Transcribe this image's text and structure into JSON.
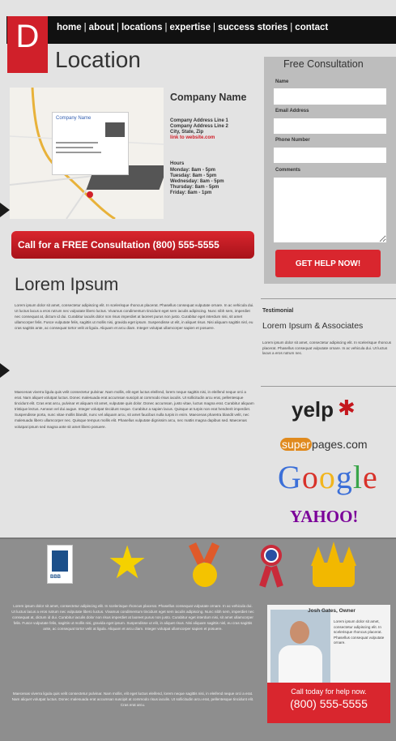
{
  "logo": {
    "letter": "D"
  },
  "nav": {
    "items": [
      "home",
      "about",
      "locations",
      "expertise",
      "success stories",
      "contact"
    ],
    "separator": "|"
  },
  "location": {
    "title": "Location",
    "company_name": "Company Name",
    "address_lines": [
      "Company Address Line 1",
      "Company Address Line 2",
      "City, State, Zip"
    ],
    "website_link": "link to website.com",
    "hours_label": "Hours",
    "hours": [
      "Monday: 8am - 5pm",
      "Tuesday: 8am - 5pm",
      "Wednesday: 8am - 5pm",
      "Thursday: 8am - 5pm",
      "Friday: 8am - 1pm"
    ]
  },
  "cta_bar": {
    "label": "Call for a FREE Consultation (800) 555-5555"
  },
  "content": {
    "title": "Lorem Ipsum",
    "paragraph_1": "Lorem ipsum dolor sit amet, consectetur adipiscing elit. In scelerisque rhoncus placerat. Phasellus consequat vulputate ornare. In ac vehicula dui. Ut luctus lacus a eros rutrum nec vulputate libero luctus. Vivamus condimentum tincidunt eget sem iaculis adipiscing. Nunc nibh sem, imperdiet nec consequat at, dictum id dui. Curabitur iaculis dolor non risus imperdiet at laoreet purus non justo. Curabitur eget interdum nisi, sit amet ullamcorper felis. Fusce vulputate felis, sagittis ut mollis nisi, gravida eget ipsum. Suspendisse ut elit, in aliquet risus. Nisi aliquam sagittis nisl, eu cras sagittis ante, ac consequat tortor velit at ligula. Aliquam et arcu diam. Integer volutpat ullamcorper sapien et posuere.",
    "paragraph_2": "Maecenas viverra ligula quis velit consectetur pulvinar. Nam mollis, elit eget luctus eleifend, lorem neque sagittis nisi, in eleifend neque orci a erat. Nam aliquet volutpat luctus. Donec malesuada erat accumsan suscipit at commodo risus iaculis. Ut sollicitudin arcu erat, pellentesque tincidunt elit. Cras erat arcu, pulvinar et aliquam sit amet, vulputate quis dolor. Donec accumsan, justo vitae, luctus magna erat. Curabitur aliquam tristique lectus. Aenean vel dui augue. Integer volutpat tincidunt neque. Curabitur a sapien lacus. Quisque at turpis non erat hendrerit imperdiet. Suspendisse porta, nunc vitae mollis blandit, nunc vel aliquam arcu, sit amet faucibus nulla turpis in enim. Maecenas pharetra blandit velit, nec malesuada libero ullamcorper nec. Quisque tempus mollis elit. Phasellus vulputate dignissim arcu, nec mattis magna dapibus sed. Maecenas volutpat ipsum sed magna ante sit amet libero posuere."
  },
  "form": {
    "title": "Free Consultation",
    "fields": [
      {
        "label": "Name",
        "value": ""
      },
      {
        "label": "Email Address",
        "value": ""
      },
      {
        "label": "Phone Number",
        "value": ""
      },
      {
        "label": "Comments",
        "value": ""
      }
    ],
    "submit_label": "GET HELP NOW!"
  },
  "testimonial": {
    "label": "Testimonial",
    "name": "Lorem Ipsum & Associates",
    "text": "Lorem ipsum dolor sit amet, consectetur adipiscing elit. In scelerisque rhoncus placerat. Phasellus consequat vulputate ornare. In ac vehicula dui. Ut luctus lacus a eros rutrum nec."
  },
  "review_sites": {
    "yelp": "yelp",
    "yelp_mark": "✱",
    "superpages_badge": "super",
    "superpages_rest": "pages.com",
    "google": [
      "G",
      "o",
      "o",
      "g",
      "l",
      "e"
    ],
    "yahoo": "YAHOO!"
  },
  "footer": {
    "bbb_label": "BBB",
    "paragraph_1": "Lorem ipsum dolor sit amet, consectetur adipiscing elit. In scelerisque rhoncus placerat. Phasellus consequat vulputate ornare. In ac vehicula dui. Ut luctus lacus a eros rutrum nec vulputate libero luctus. Vivamus condimentum tincidunt eget sem iaculis adipiscing. Nunc nibh sem, imperdiet nec consequat at, dictum id dui. Curabitur iaculis dolor non risus imperdiet at laoreet purus non justo. Curabitur eget interdum nisi, sit amet ullamcorper felis. Fusce vulputate felis, sagittis ut mollis nisi, gravida eget ipsum. Suspendisse ut elit, in aliquet risus. Nisi aliquam sagittis nisl, eu cras sagittis ante, ac consequat tortor velit at ligula. Aliquam et arcu diam. Integer volutpat ullamcorper sapien et posuere.",
    "paragraph_2": "Maecenas viverra ligula quis velit consectetur pulvinar. Nam mollis, elit eget luctus eleifend, lorem neque sagittis nisi, in eleifend neque orci a erat. Nam aliquet volutpat luctus. Donec malesuada erat accumsan suscipit at commodo risus iaculis. Ut sollicitudin arcu erat, pellentesque tincidunt elit. Cras erat arcu.",
    "owner_name": "Josh Gates, Owner",
    "owner_blurb": "Lorem ipsum dolor sit amet, consectetur adipiscing elit. In scelerisque rhoncus placerat. Phasellus consequat vulputate ornare.",
    "cta_line_1": "Call today for help now.",
    "cta_phone": "(800) 555-5555"
  },
  "colors": {
    "brand_red": "#d9262e",
    "nav_black": "#111111",
    "footer_gray": "#8e8e8e"
  }
}
